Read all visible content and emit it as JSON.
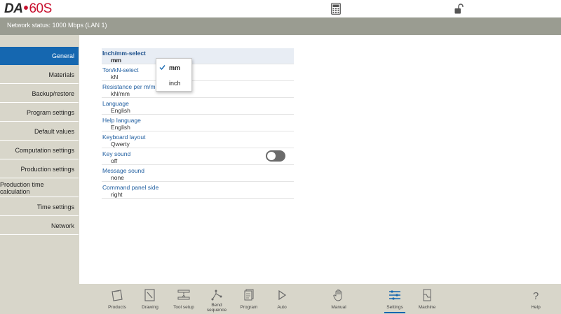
{
  "header": {
    "logo_brand": "DA",
    "logo_model": "60S"
  },
  "status": {
    "network_text": "Network status: 1000 Mbps (LAN 1)"
  },
  "sidebar": {
    "items": [
      {
        "label": "General",
        "active": true
      },
      {
        "label": "Materials"
      },
      {
        "label": "Backup/restore"
      },
      {
        "label": "Program settings"
      },
      {
        "label": "Default values"
      },
      {
        "label": "Computation settings"
      },
      {
        "label": "Production settings"
      },
      {
        "label": "Production time calculation"
      },
      {
        "label": "Time settings"
      },
      {
        "label": "Network"
      }
    ]
  },
  "settings": {
    "rows": [
      {
        "label": "Inch/mm-select",
        "value": "mm"
      },
      {
        "label": "Ton/kN-select",
        "value": "kN"
      },
      {
        "label": "Resistance per m/mm",
        "value": "kN/mm"
      },
      {
        "label": "Language",
        "value": "English"
      },
      {
        "label": "Help language",
        "value": "English"
      },
      {
        "label": "Keyboard layout",
        "value": "Qwerty"
      },
      {
        "label": "Key sound",
        "value": "off"
      },
      {
        "label": "Message sound",
        "value": "none"
      },
      {
        "label": "Command panel side",
        "value": "right"
      }
    ]
  },
  "dropdown": {
    "options": [
      {
        "label": "mm",
        "selected": true
      },
      {
        "label": "inch"
      }
    ]
  },
  "toolbar": {
    "items": [
      {
        "label": "Products",
        "icon": "products-icon"
      },
      {
        "label": "Drawing",
        "icon": "drawing-icon"
      },
      {
        "label": "Tool setup",
        "icon": "tool-setup-icon"
      },
      {
        "label_line1": "Bend",
        "label_line2": "sequence",
        "icon": "bend-sequence-icon"
      },
      {
        "label": "Program",
        "icon": "program-icon"
      },
      {
        "label": "Auto",
        "icon": "auto-play-icon"
      },
      {
        "label": "Manual",
        "icon": "hand-icon"
      },
      {
        "label": "Settings",
        "icon": "settings-list-icon",
        "active": true
      },
      {
        "label": "Machine",
        "icon": "machine-icon"
      },
      {
        "label": "Help",
        "icon": "help-icon"
      }
    ]
  },
  "colors": {
    "accent": "#1567b0",
    "status_bar": "#9a9c91",
    "panel": "#d8d6ca",
    "logo_red": "#c8102e"
  }
}
